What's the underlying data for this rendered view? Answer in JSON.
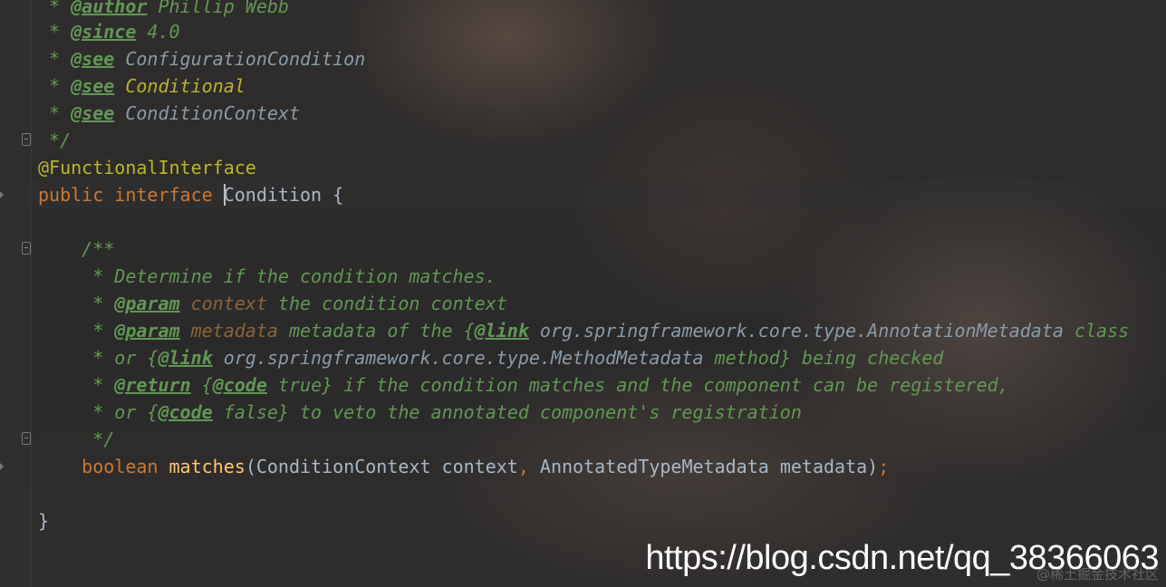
{
  "editor": {
    "lines": {
      "author": {
        "star": " * ",
        "tag": "@author",
        "text": " Phillip Webb"
      },
      "since": {
        "star": " * ",
        "tag": "@since",
        "text": " 4.0"
      },
      "see1": {
        "star": " * ",
        "tag": "@see",
        "ref": " ConfigurationCondition"
      },
      "see2": {
        "star": " * ",
        "tag": "@see",
        "ref": " Conditional"
      },
      "see3": {
        "star": " * ",
        "tag": "@see",
        "ref": " ConditionContext"
      },
      "end_doc": " */",
      "annotation": "@FunctionalInterface",
      "decl": {
        "kw1": "public",
        "kw2": "interface",
        "name_first": "C",
        "name_rest": "ondition",
        "brace": " {"
      },
      "doc_open": "    /**",
      "doc1": "     * Determine if the condition matches.",
      "doc2": {
        "star": "     * ",
        "tag": "@param",
        "param": " context",
        "text": " the condition context"
      },
      "doc3": {
        "star": "     * ",
        "tag": "@param",
        "param": " metadata",
        "text": " metadata of the {",
        "link": "@link",
        "ref": " org.springframework.core.type.AnnotationMetadata",
        "tail": " class"
      },
      "doc4": {
        "pre": "     * or {",
        "link": "@link",
        "ref": " org.springframework.core.type.MethodMetadata",
        "tail": " method} being checked"
      },
      "doc5": {
        "star": "     * ",
        "tag": "@return",
        "pre": " {",
        "code": "@code",
        "tail": " true} if the condition matches and the component can be registered,"
      },
      "doc6": {
        "pre": "     * or {",
        "code": "@code",
        "tail": " false} to veto the annotated component's registration"
      },
      "doc_close": "     */",
      "method": {
        "indent": "    ",
        "kw": "boolean",
        "name": "matches",
        "params": "(ConditionContext context",
        "comma": ",",
        "params2": " AnnotatedTypeMetadata metadata)",
        "semi": ";"
      },
      "close": "}"
    }
  },
  "watermark": {
    "url": "https://blog.csdn.net/qq_38366063",
    "faint": "@稀土掘金技术社区"
  },
  "colors": {
    "background": "#2b2b2b",
    "doc_comment": "#629755",
    "keyword": "#cc7832",
    "annotation": "#bbb529",
    "identifier": "#a9b7c6",
    "method": "#ffc66d"
  }
}
